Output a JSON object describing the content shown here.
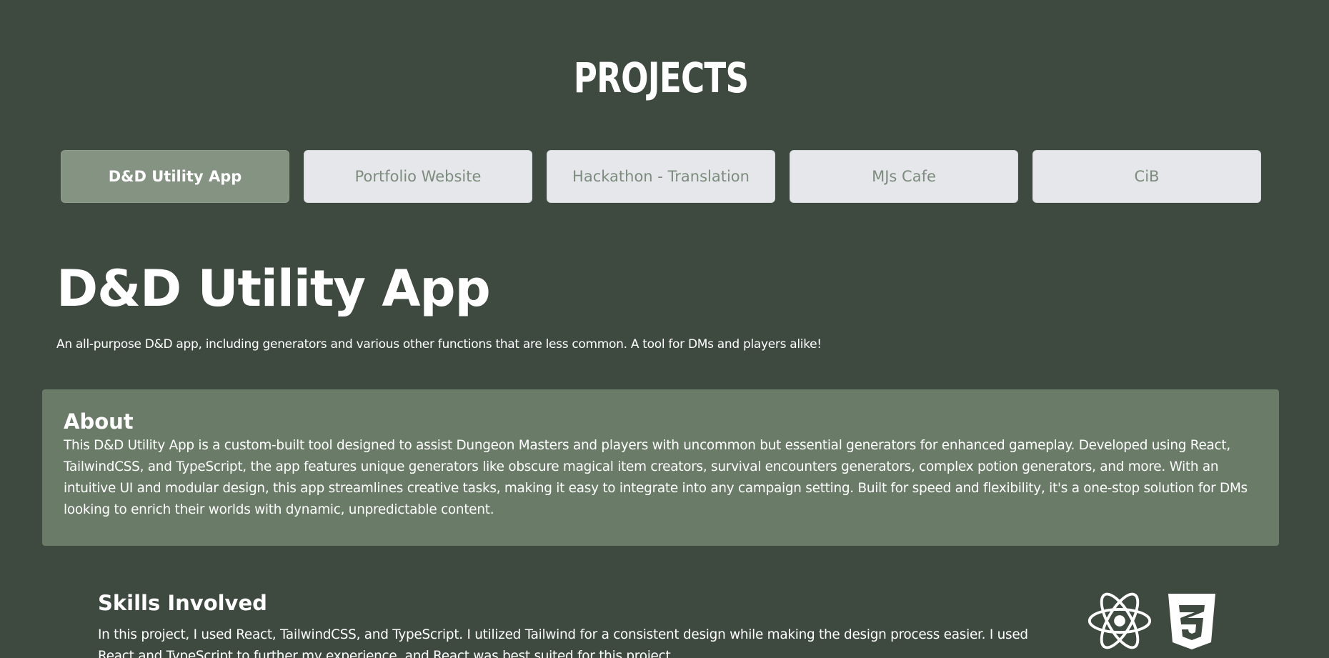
{
  "header": {
    "title": "PROJECTS"
  },
  "tabs": [
    {
      "label": "D&D Utility App",
      "active": true
    },
    {
      "label": "Portfolio Website",
      "active": false
    },
    {
      "label": "Hackathon - Translation",
      "active": false
    },
    {
      "label": "MJs Cafe",
      "active": false
    },
    {
      "label": "CiB",
      "active": false
    }
  ],
  "project": {
    "title": "D&D Utility App",
    "subtitle": "An all-purpose D&D app, including generators and various other functions that are less common. A tool for DMs and players alike!",
    "about": {
      "heading": "About",
      "body": "This D&D Utility App is a custom-built tool designed to assist Dungeon Masters and players with uncommon but essential generators for enhanced gameplay. Developed using React, TailwindCSS, and TypeScript, the app features unique generators like obscure magical item creators, survival encounters generators, complex potion generators, and more. With an intuitive UI and modular design, this app streamlines creative tasks, making it easy to integrate into any campaign setting. Built for speed and flexibility, it's a one-stop solution for DMs looking to enrich their worlds with dynamic, unpredictable content."
    },
    "skills": {
      "heading": "Skills Involved",
      "body": "In this project, I used React, TailwindCSS, and TypeScript. I utilized Tailwind for a consistent design while making the design process easier. I used React and TypeScript to further my experience, and React was best suited for this project.",
      "icons": [
        "react-icon",
        "css3-icon"
      ]
    }
  },
  "colors": {
    "background": "#3e4940",
    "tab_active": "#849382",
    "tab_inactive": "#e5e7ea",
    "tab_inactive_text": "#7d8c7e",
    "card": "#6a7c68"
  }
}
